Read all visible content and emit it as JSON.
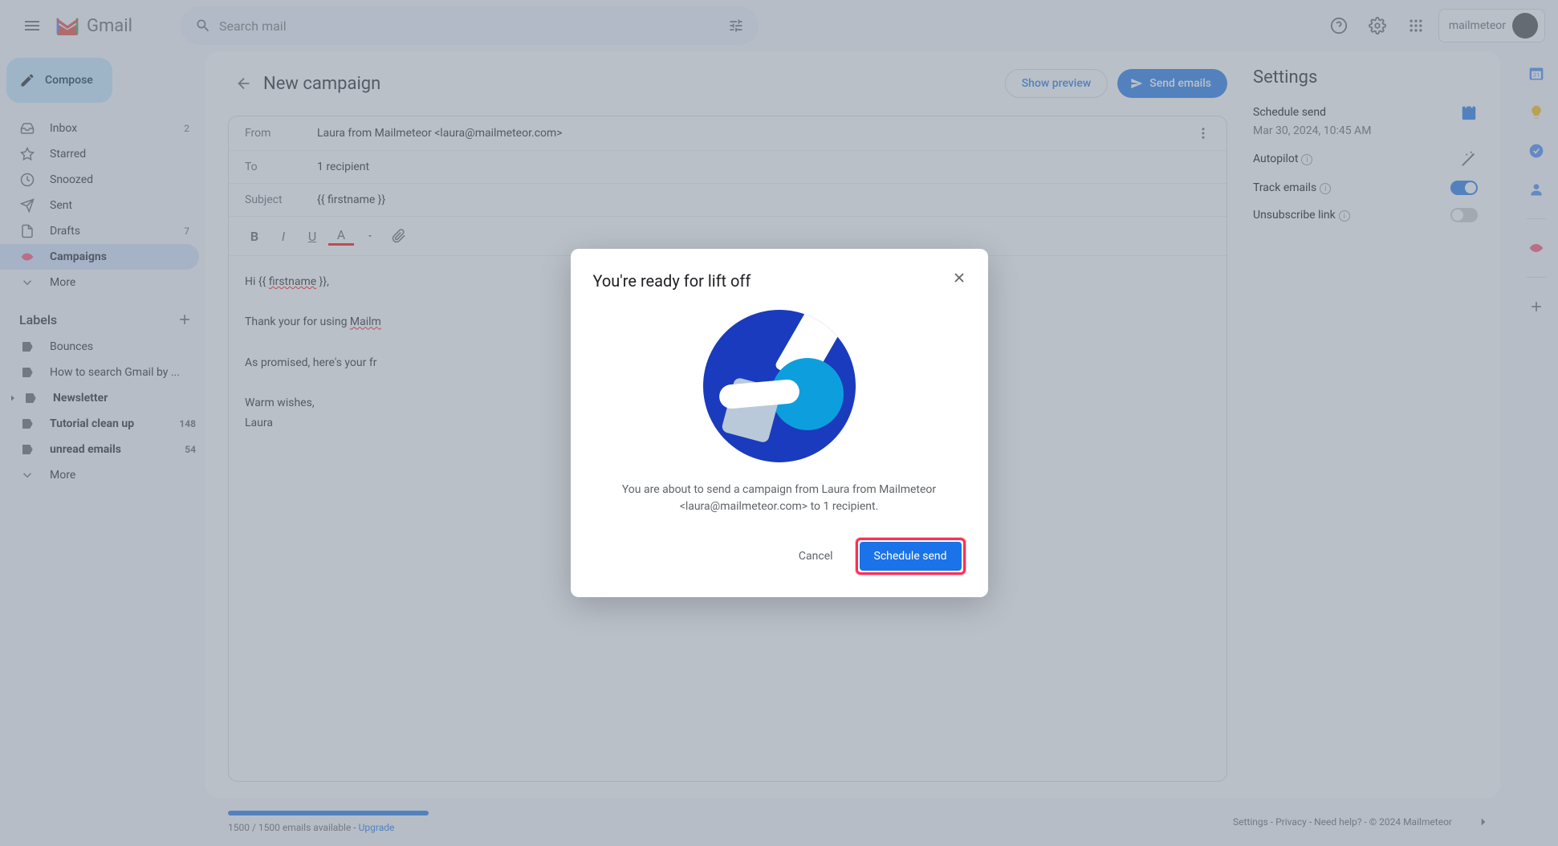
{
  "header": {
    "gmail_text": "Gmail",
    "search_placeholder": "Search mail",
    "account_name": "mailmeteor"
  },
  "sidebar": {
    "compose": "Compose",
    "items": [
      {
        "label": "Inbox",
        "count": "2",
        "icon": "inbox"
      },
      {
        "label": "Starred",
        "count": "",
        "icon": "star"
      },
      {
        "label": "Snoozed",
        "count": "",
        "icon": "clock"
      },
      {
        "label": "Sent",
        "count": "",
        "icon": "send"
      },
      {
        "label": "Drafts",
        "count": "7",
        "icon": "file"
      },
      {
        "label": "Campaigns",
        "count": "",
        "icon": "campaign"
      },
      {
        "label": "More",
        "count": "",
        "icon": "chevron"
      }
    ],
    "labels_title": "Labels",
    "labels": [
      {
        "label": "Bounces",
        "count": "",
        "bold": false
      },
      {
        "label": "How to search Gmail by ...",
        "count": "",
        "bold": false
      },
      {
        "label": "Newsletter",
        "count": "",
        "bold": true,
        "expandable": true
      },
      {
        "label": "Tutorial clean up",
        "count": "148",
        "bold": true
      },
      {
        "label": "unread emails",
        "count": "54",
        "bold": true
      },
      {
        "label": "More",
        "count": "",
        "bold": false,
        "icon": "chevron"
      }
    ]
  },
  "campaign": {
    "title": "New campaign",
    "preview_btn": "Show preview",
    "send_btn": "Send emails",
    "from_label": "From",
    "from_value": "Laura from Mailmeteor <laura@mailmeteor.com>",
    "to_label": "To",
    "to_value": "1 recipient",
    "subject_label": "Subject",
    "subject_value": "{{ firstname }}",
    "body_greeting": "Hi {{ firstname }},",
    "body_line1": "Thank your for using Mailm",
    "body_line2": "As promised, here's your fr",
    "body_signoff": "Warm wishes,",
    "body_name": "Laura"
  },
  "settings": {
    "title": "Settings",
    "schedule_label": "Schedule send",
    "schedule_time": "Mar 30, 2024, 10:45 AM",
    "autopilot": "Autopilot",
    "track": "Track emails",
    "unsubscribe": "Unsubscribe link"
  },
  "footer": {
    "quota": "1500 / 1500 emails available - ",
    "upgrade": "Upgrade",
    "links": "Settings - Privacy - Need help? - © 2024 Mailmeteor"
  },
  "modal": {
    "title": "You're ready for lift off",
    "text": "You are about to send a campaign from Laura from Mailmeteor <laura@mailmeteor.com> to 1 recipient.",
    "cancel": "Cancel",
    "schedule": "Schedule send"
  }
}
